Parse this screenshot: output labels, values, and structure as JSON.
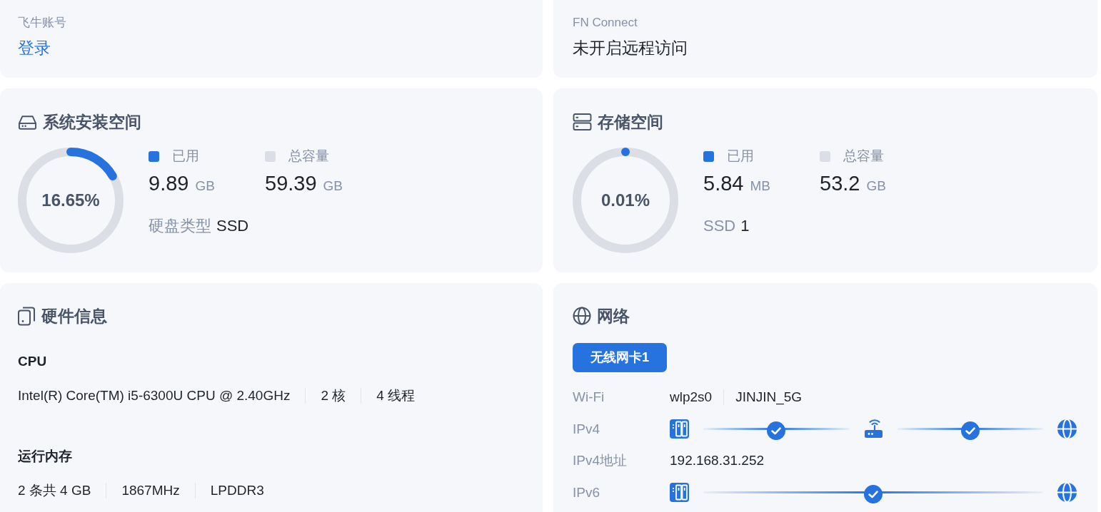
{
  "account": {
    "label": "飞牛账号",
    "action": "登录"
  },
  "fn_connect": {
    "label": "FN Connect",
    "status": "未开启远程访问"
  },
  "system_space": {
    "title": "系统安装空间",
    "percent": "16.65%",
    "legend": [
      {
        "label": "已用",
        "color": "#2673e0",
        "value": "9.89",
        "unit": "GB"
      },
      {
        "label": "总容量",
        "color": "#dcdee5",
        "value": "59.39",
        "unit": "GB"
      }
    ],
    "detail": {
      "label": "硬盘类型",
      "value": "SSD"
    }
  },
  "storage_space": {
    "title": "存储空间",
    "percent": "0.01%",
    "legend": [
      {
        "label": "已用",
        "color": "#2673e0",
        "value": "5.84",
        "unit": "MB"
      },
      {
        "label": "总容量",
        "color": "#dcdee5",
        "value": "53.2",
        "unit": "GB"
      }
    ],
    "detail": {
      "label": "SSD",
      "value": "1"
    }
  },
  "hardware": {
    "title": "硬件信息",
    "sections": [
      {
        "heading": "CPU",
        "items": [
          "Intel(R) Core(TM) i5-6300U CPU @ 2.40GHz",
          "2 核",
          "4 线程"
        ]
      },
      {
        "heading": "运行内存",
        "items": [
          "2 条共 4 GB",
          "1867MHz",
          "LPDDR3"
        ]
      }
    ]
  },
  "network": {
    "title": "网络",
    "tabs": [
      {
        "label": "无线网卡1",
        "selected": true
      }
    ],
    "rows": [
      {
        "kind": "text",
        "label": "Wi-Fi",
        "values": [
          "wlp2s0",
          "JINJIN_5G"
        ]
      },
      {
        "kind": "path",
        "label": "IPv4",
        "nodes": [
          {
            "kind": "device"
          },
          {
            "kind": "router"
          },
          {
            "kind": "internet"
          }
        ],
        "links": [
          {
            "connected": true
          },
          {
            "connected": true
          }
        ]
      },
      {
        "kind": "text",
        "label": "IPv4地址",
        "values": [
          "192.168.31.252"
        ]
      },
      {
        "kind": "path",
        "label": "IPv6",
        "nodes": [
          {
            "kind": "device"
          },
          {
            "kind": "internet"
          }
        ],
        "links": [
          {
            "connected": true
          }
        ]
      }
    ]
  }
}
